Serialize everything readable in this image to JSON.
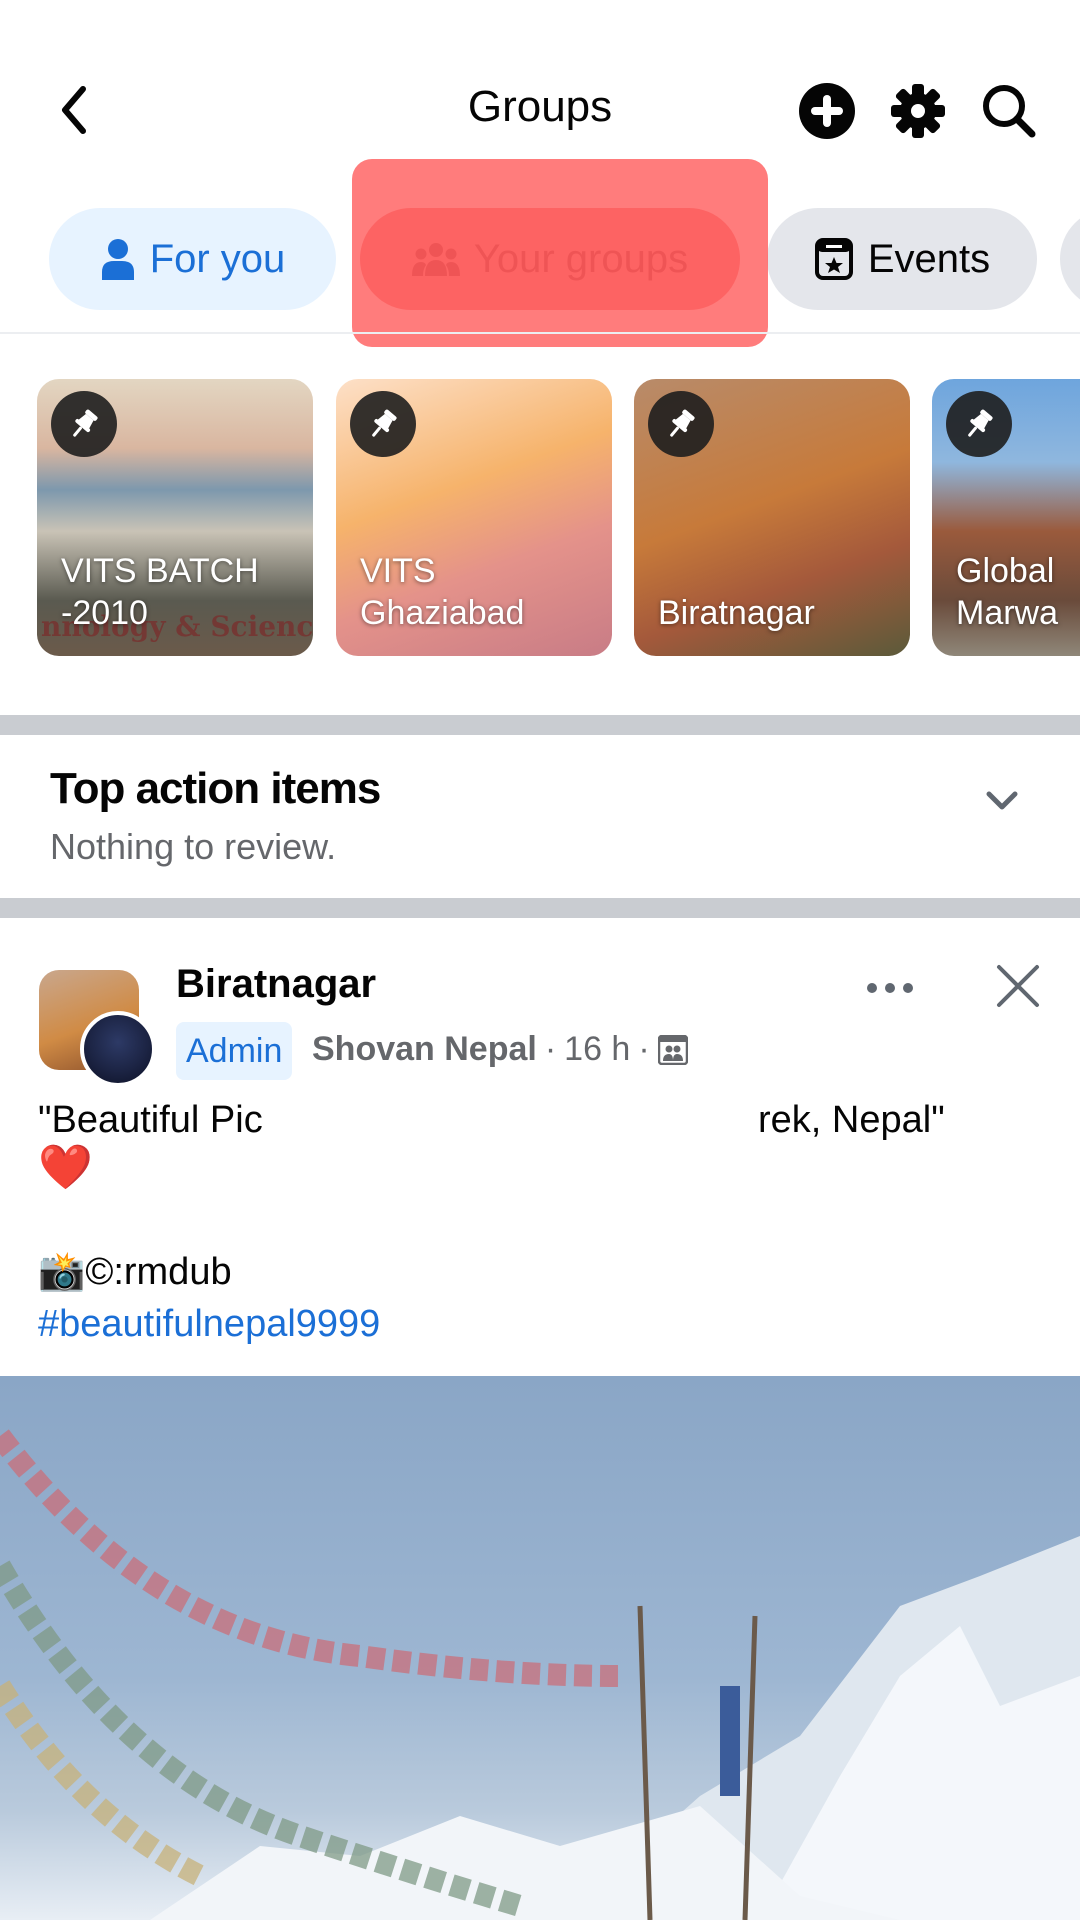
{
  "header": {
    "title": "Groups",
    "back_icon": "chevron-left-icon",
    "actions": [
      {
        "name": "add",
        "icon": "plus-circle-icon"
      },
      {
        "name": "settings",
        "icon": "gear-icon"
      },
      {
        "name": "search",
        "icon": "search-icon"
      }
    ]
  },
  "tabs": [
    {
      "label": "For you",
      "icon": "person-icon",
      "active": true
    },
    {
      "label": "Your groups",
      "icon": "people-icon",
      "active": false,
      "highlighted": true
    },
    {
      "label": "Events",
      "icon": "calendar-star-icon",
      "active": false
    }
  ],
  "pinned_groups": [
    {
      "name": "VITS BATCH -2010",
      "line1": "VITS BATCH",
      "line2": "-2010",
      "overlay_text": "nnology & Science",
      "pinned": true
    },
    {
      "name": "VITS Ghaziabad",
      "line1": "VITS",
      "line2": "Ghaziabad",
      "pinned": true
    },
    {
      "name": "Biratnagar",
      "line1": "",
      "line2": "Biratnagar",
      "pinned": true
    },
    {
      "name": "Global Marwa...",
      "line1": "Global",
      "line2": "Marwa",
      "pinned": true
    }
  ],
  "action_items": {
    "title": "Top action items",
    "subtitle": "Nothing to review."
  },
  "post": {
    "group": "Biratnagar",
    "badge": "Admin",
    "author": "Shovan Nepal",
    "time": "16 h",
    "separator": "·",
    "audience_icon": "group-audience-icon",
    "text_start": "\"Beautiful Pic",
    "text_end": "rek, Nepal\"",
    "heart": "❤️",
    "credit": "📸©:rmdub",
    "hashtag": "#beautifulnepal9999"
  },
  "colors": {
    "accent": "#1b6fd6",
    "active_tab_bg": "#e7f3ff",
    "pill_bg": "#e4e6eb",
    "highlight": "#ff5f5f",
    "separator": "#c9ccd1"
  }
}
